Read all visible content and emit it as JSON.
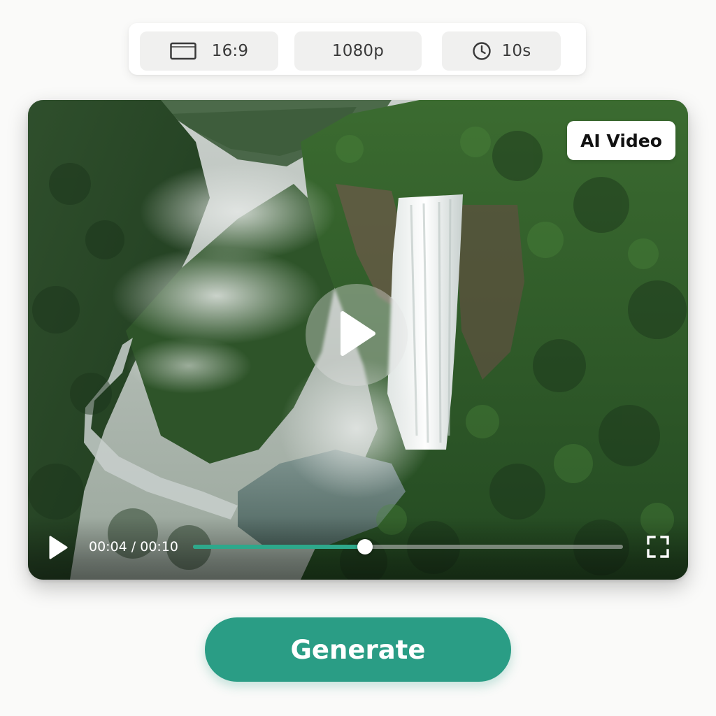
{
  "settings": {
    "aspect_ratio": {
      "icon": "aspect-ratio-icon",
      "label": "16:9"
    },
    "resolution": {
      "label": "1080p"
    },
    "duration": {
      "icon": "clock-icon",
      "label": "10s"
    }
  },
  "player": {
    "badge": "AI Video",
    "current_time": "00:04",
    "separator": " / ",
    "total_time": "00:10",
    "progress": 0.4,
    "icons": {
      "center": "play-icon",
      "control": "play-icon",
      "fullscreen": "fullscreen-icon"
    },
    "scene": "waterfall-in-jungle-gorge"
  },
  "actions": {
    "generate_label": "Generate"
  },
  "colors": {
    "accent": "#2a9d85",
    "progress_fill": "#2ea88b",
    "chip_bg": "#f0f0ef",
    "page_bg": "#fafaf9"
  }
}
